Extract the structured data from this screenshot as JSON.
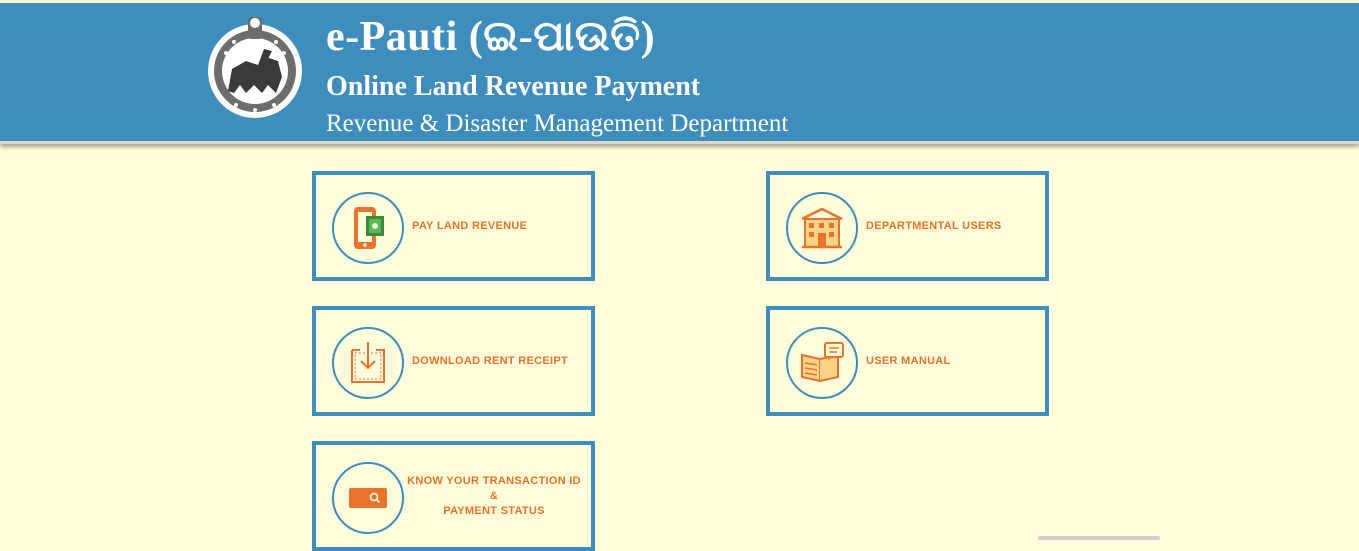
{
  "header": {
    "title": "e-Pauti (ଇ-ପାଉତି)",
    "subtitle": "Online Land Revenue Payment",
    "department": "Revenue & Disaster Management Department",
    "emblem_icon": "odisha-emblem-icon"
  },
  "cards": {
    "pay_land_revenue": {
      "label": "PAY LAND REVENUE",
      "icon": "mobile-payment-icon"
    },
    "departmental_users": {
      "label": "DEPARTMENTAL USERS",
      "icon": "office-building-icon"
    },
    "download_rent_receipt": {
      "label": "DOWNLOAD RENT RECEIPT",
      "icon": "download-document-icon"
    },
    "user_manual": {
      "label": "USER MANUAL",
      "icon": "manual-book-icon"
    },
    "know_transaction": {
      "line1": "KNOW YOUR TRANSACTION ID",
      "line2": "&",
      "line3": "PAYMENT STATUS",
      "icon": "search-card-icon"
    }
  },
  "colors": {
    "header_bg": "#3e8dbd",
    "page_bg": "#fffddc",
    "accent_orange": "#e8732a",
    "card_border": "#3e8dbd"
  }
}
